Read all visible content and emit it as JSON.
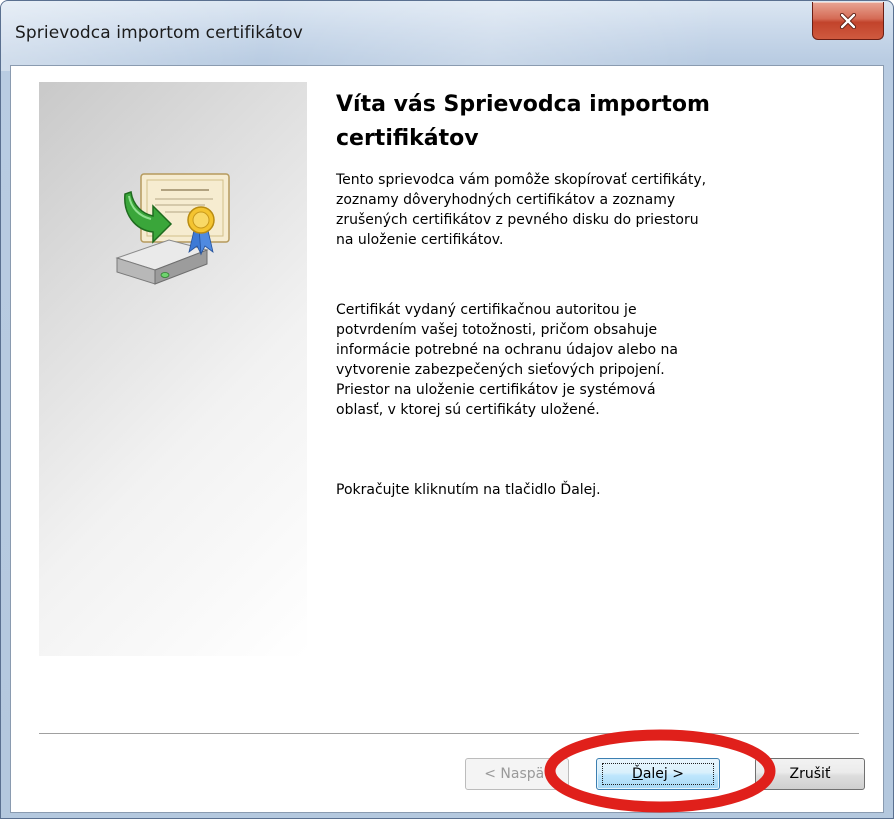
{
  "window": {
    "title": "Sprievodca importom certifikátov"
  },
  "content": {
    "heading": "Víta vás Sprievodca importom certifikátov",
    "paragraphs": [
      "Tento sprievodca vám pomôže skopírovať certifikáty,\nzoznamy dôveryhodných certifikátov a zoznamy\nzrušených certifikátov z pevného disku do priestoru\nna uloženie certifikátov.",
      "Certifikát vydaný certifikačnou autoritou je\npotvrdením vašej totožnosti, pričom obsahuje\ninformácie potrebné na ochranu údajov alebo na\nvytvorenie zabezpečených sieťových pripojení.\nPriestor na uloženie certifikátov je systémová\noblasť, v ktorej sú certifikáty uložené.",
      "Pokračujte kliknutím na tlačidlo Ďalej."
    ]
  },
  "buttons": {
    "back": {
      "label": "< Naspäť",
      "enabled": false
    },
    "next": {
      "accelerator": "Ď",
      "label_rest": "alej >",
      "focused": true
    },
    "cancel": {
      "label": "Zrušiť"
    }
  },
  "icons": {
    "close": "close-icon",
    "wizard_graphic": "certificate-import-icon"
  },
  "colors": {
    "annotation": "#e0201b",
    "close_button": "#c7452e",
    "focused_button_border": "#3c7fb1"
  }
}
